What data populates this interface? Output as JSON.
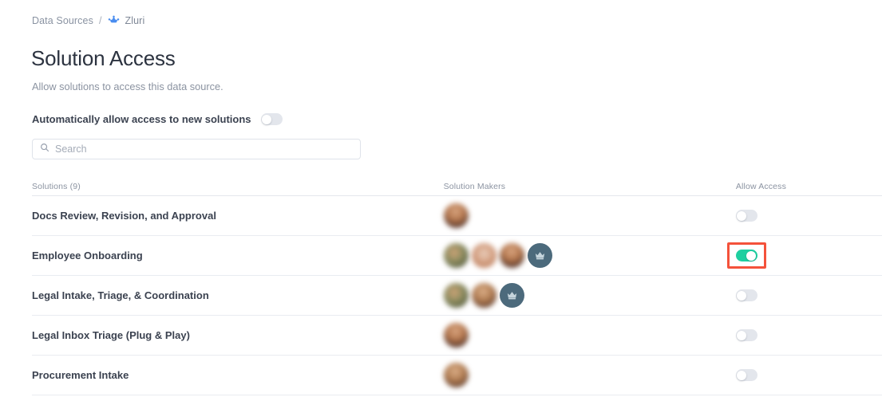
{
  "breadcrumb": {
    "parent": "Data Sources",
    "separator": "/",
    "current": "Zluri",
    "current_icon": "zluri-logo-icon"
  },
  "page": {
    "title": "Solution Access",
    "subtitle": "Allow solutions to access this data source."
  },
  "auto_allow": {
    "label": "Automatically allow access to new solutions",
    "enabled": false
  },
  "search": {
    "placeholder": "Search",
    "value": "",
    "icon": "search-icon"
  },
  "table": {
    "headers": {
      "solutions": "Solutions (9)",
      "makers": "Solution Makers",
      "access": "Allow Access"
    },
    "rows": [
      {
        "name": "Docs Review, Revision, and Approval",
        "makers": [
          {
            "type": "photo",
            "style": "a1"
          }
        ],
        "allow_access": false,
        "highlighted": false
      },
      {
        "name": "Employee Onboarding",
        "makers": [
          {
            "type": "photo",
            "style": "a2"
          },
          {
            "type": "photo",
            "style": "a3"
          },
          {
            "type": "photo",
            "style": "a1"
          },
          {
            "type": "icon",
            "icon": "crown-icon"
          }
        ],
        "allow_access": true,
        "highlighted": true
      },
      {
        "name": "Legal Intake, Triage, & Coordination",
        "makers": [
          {
            "type": "photo",
            "style": "a2"
          },
          {
            "type": "photo",
            "style": "a4"
          },
          {
            "type": "icon",
            "icon": "crown-icon"
          }
        ],
        "allow_access": false,
        "highlighted": false
      },
      {
        "name": "Legal Inbox Triage (Plug & Play)",
        "makers": [
          {
            "type": "photo",
            "style": "a1"
          }
        ],
        "allow_access": false,
        "highlighted": false
      },
      {
        "name": "Procurement Intake",
        "makers": [
          {
            "type": "photo",
            "style": "a4"
          }
        ],
        "allow_access": false,
        "highlighted": false
      }
    ]
  },
  "colors": {
    "toggle_on": "#1ecfa0",
    "toggle_off": "#e3e6ec",
    "highlight_border": "#f4523b",
    "accent_link": "#4a8df0",
    "text_primary": "#3b4250",
    "text_muted": "#8b93a1"
  }
}
